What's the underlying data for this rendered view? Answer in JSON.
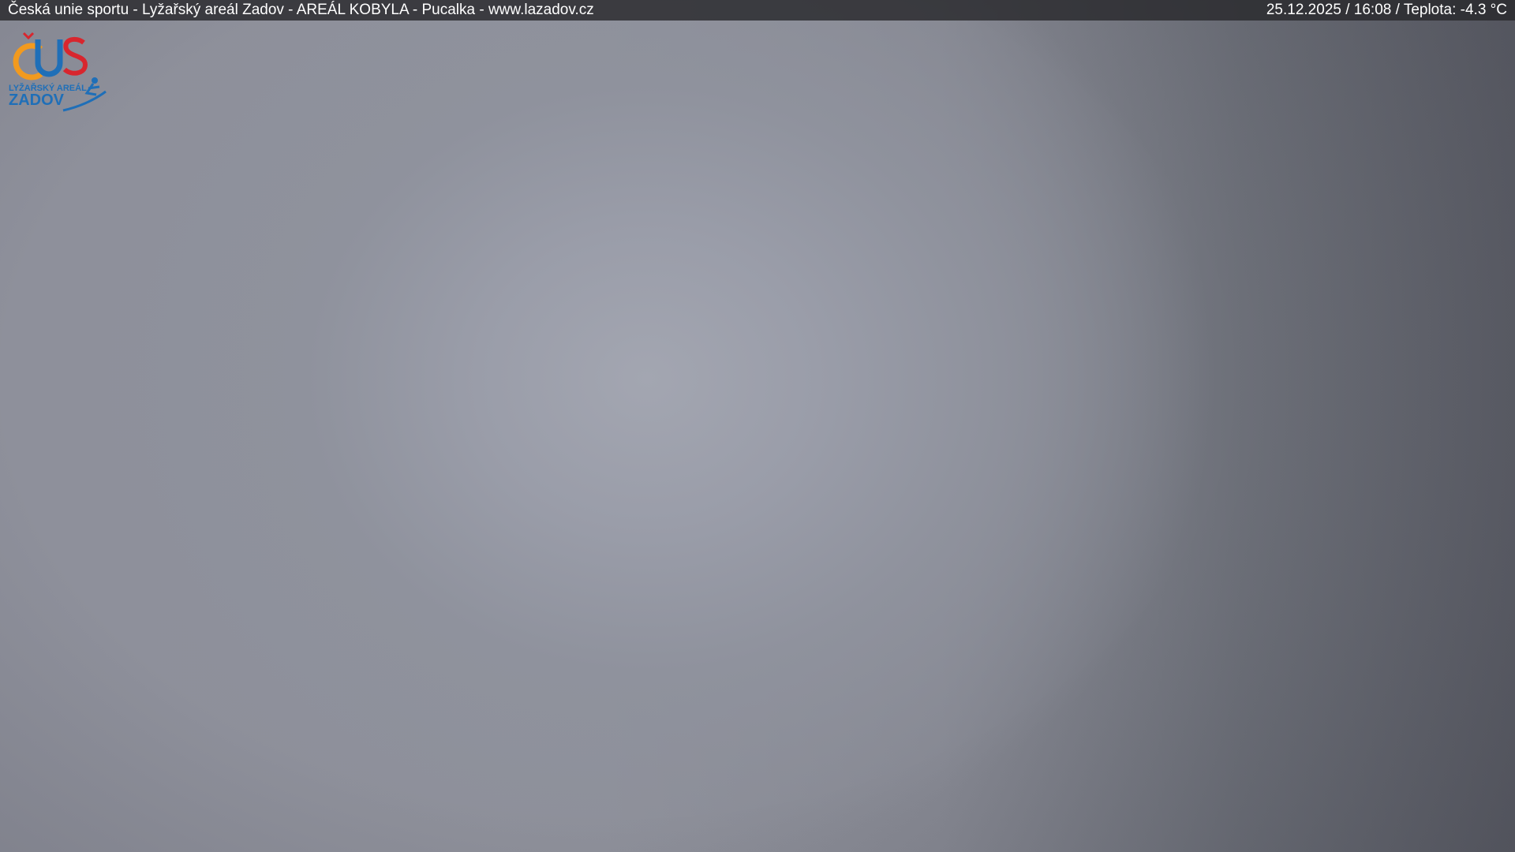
{
  "overlay": {
    "caption": "Česká unie sportu - Lyžařský areál Zadov - AREÁL KOBYLA - Pucalka - www.lazadov.cz",
    "status": "25.12.2025 / 16:08 / Teplota: -4.3 °C"
  },
  "logo": {
    "mark_text": "ČUS",
    "subtitle": "LYŽAŘSKÝ AREÁL",
    "name": "ZADOV",
    "icon": "skier-icon",
    "colors": {
      "orange": "#f29a1e",
      "blue": "#1f6fb8",
      "red": "#d8262e"
    }
  },
  "scene": {
    "description_color_center": "#a3a6b1",
    "description_color_edge": "#5f616a"
  }
}
